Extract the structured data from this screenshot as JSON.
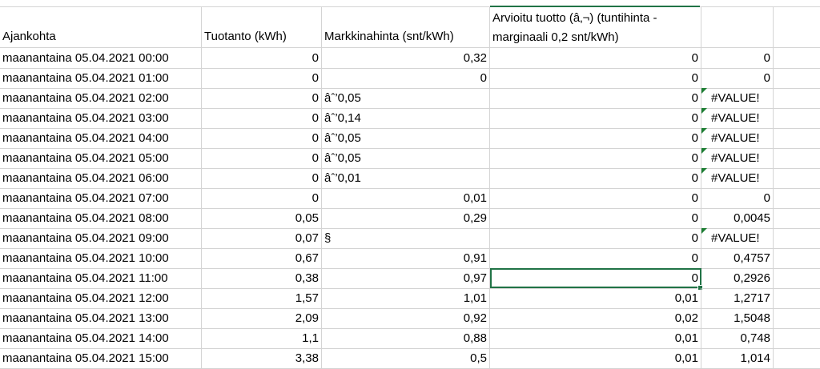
{
  "headers": {
    "c1": "Ajankohta",
    "c2": "Tuotanto (kWh)",
    "c3": "Markkinahinta (snt/kWh)",
    "c4_line1": "Arvioitu tuotto (â‚¬) (tuntihinta -",
    "c4_line2": "marginaali 0,2 snt/kWh)",
    "c5": ""
  },
  "rows": [
    {
      "time": "maanantaina 05.04.2021 00:00",
      "prod": "0",
      "price": "0,32",
      "price_left": false,
      "est": "0",
      "calc": "0",
      "flag": false
    },
    {
      "time": "maanantaina 05.04.2021 01:00",
      "prod": "0",
      "price": "0",
      "price_left": false,
      "est": "0",
      "calc": "0",
      "flag": false
    },
    {
      "time": "maanantaina 05.04.2021 02:00",
      "prod": "0",
      "price": "âˆ’0,05",
      "price_left": true,
      "est": "0",
      "calc": "#VALUE!",
      "flag": true
    },
    {
      "time": "maanantaina 05.04.2021 03:00",
      "prod": "0",
      "price": "âˆ’0,14",
      "price_left": true,
      "est": "0",
      "calc": "#VALUE!",
      "flag": true
    },
    {
      "time": "maanantaina 05.04.2021 04:00",
      "prod": "0",
      "price": "âˆ’0,05",
      "price_left": true,
      "est": "0",
      "calc": "#VALUE!",
      "flag": true
    },
    {
      "time": "maanantaina 05.04.2021 05:00",
      "prod": "0",
      "price": "âˆ’0,05",
      "price_left": true,
      "est": "0",
      "calc": "#VALUE!",
      "flag": true
    },
    {
      "time": "maanantaina 05.04.2021 06:00",
      "prod": "0",
      "price": "âˆ’0,01",
      "price_left": true,
      "est": "0",
      "calc": "#VALUE!",
      "flag": true
    },
    {
      "time": "maanantaina 05.04.2021 07:00",
      "prod": "0",
      "price": "0,01",
      "price_left": false,
      "est": "0",
      "calc": "0",
      "flag": false
    },
    {
      "time": "maanantaina 05.04.2021 08:00",
      "prod": "0,05",
      "price": "0,29",
      "price_left": false,
      "est": "0",
      "calc": "0,0045",
      "flag": false
    },
    {
      "time": "maanantaina 05.04.2021 09:00",
      "prod": "0,07",
      "price": "§",
      "price_left": true,
      "est": "0",
      "calc": "#VALUE!",
      "flag": true
    },
    {
      "time": "maanantaina 05.04.2021 10:00",
      "prod": "0,67",
      "price": "0,91",
      "price_left": false,
      "est": "0",
      "calc": "0,4757",
      "flag": false
    },
    {
      "time": "maanantaina 05.04.2021 11:00",
      "prod": "0,38",
      "price": "0,97",
      "price_left": false,
      "est": "0",
      "calc": "0,2926",
      "flag": false,
      "active": true
    },
    {
      "time": "maanantaina 05.04.2021 12:00",
      "prod": "1,57",
      "price": "1,01",
      "price_left": false,
      "est": "0,01",
      "calc": "1,2717",
      "flag": false
    },
    {
      "time": "maanantaina 05.04.2021 13:00",
      "prod": "2,09",
      "price": "0,92",
      "price_left": false,
      "est": "0,02",
      "calc": "1,5048",
      "flag": false
    },
    {
      "time": "maanantaina 05.04.2021 14:00",
      "prod": "1,1",
      "price": "0,88",
      "price_left": false,
      "est": "0,01",
      "calc": "0,748",
      "flag": false
    },
    {
      "time": "maanantaina 05.04.2021 15:00",
      "prod": "3,38",
      "price": "0,5",
      "price_left": false,
      "est": "0,01",
      "calc": "1,014",
      "flag": false
    }
  ],
  "colors": {
    "grid": "#d4d4d4",
    "selection": "#217346",
    "error_flag": "#1e7e34"
  }
}
